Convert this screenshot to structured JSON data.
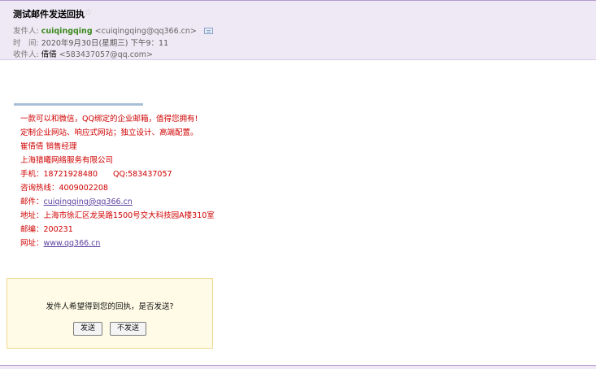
{
  "header": {
    "subject": "测试邮件发送回执",
    "star_icon": "star-icon",
    "sender_label": "发件人:",
    "sender_name": "cuiqingqing",
    "sender_email": "<cuiqingqing@qq366.cn>",
    "time_label": "时　间:",
    "time_value": "2020年9月30日(星期三) 下午9：11",
    "recipient_label": "收件人:",
    "recipient_name": "倩倩",
    "recipient_email": "<583437057@qq.com>"
  },
  "signature": {
    "lines": [
      "一款可以和微信，QQ绑定的企业邮箱，值得您拥有!",
      "定制企业网站、响应式网站；独立设计、高端配置。",
      "崔倩倩  销售经理",
      "上海猎曦网络服务有限公司",
      "手机：18721928480　　QQ:583437057",
      "咨询热线：4009002208"
    ],
    "email_label": "邮件：",
    "email_link": "cuiqingqing@qq366.cn",
    "address": "地址：上海市徐汇区龙吴路1500号交大科技园A楼310室",
    "postcode": "邮编：200231",
    "website_label": "网址：",
    "website_link": "www.qq366.cn"
  },
  "receipt": {
    "question": "发件人希望得到您的回执，是否发送?",
    "send_label": "发送",
    "nosend_label": "不发送"
  }
}
